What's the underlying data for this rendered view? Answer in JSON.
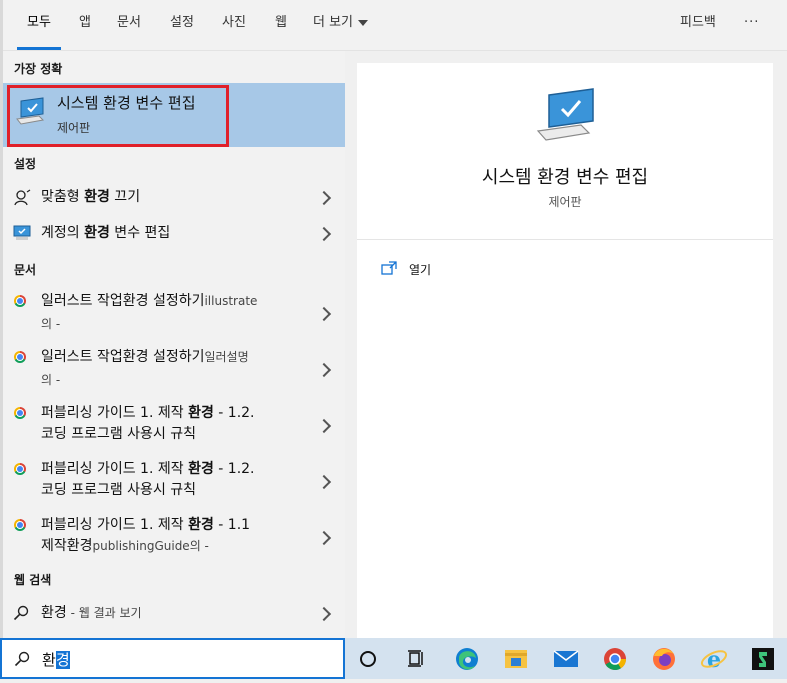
{
  "tabs": [
    {
      "label": "모두"
    },
    {
      "label": "앱"
    },
    {
      "label": "문서"
    },
    {
      "label": "설정"
    },
    {
      "label": "사진"
    },
    {
      "label": "웹"
    },
    {
      "label": "더 보기"
    }
  ],
  "feedback_label": "피드백",
  "more_options_label": "···",
  "best_match": {
    "header": "가장 정확",
    "title": "시스템 환경 변수 편집",
    "subtitle": "제어판"
  },
  "settings": {
    "header": "설정",
    "items": [
      {
        "pre": "맞춤형 ",
        "bold": "환경",
        "post": " 끄기",
        "icon": "narrator-person-icon"
      },
      {
        "pre": "계정의 ",
        "bold": "환경",
        "post": " 변수 편집",
        "icon": "monitor-icon"
      }
    ]
  },
  "documents": {
    "header": "문서",
    "items": [
      {
        "line1": "일러스트 작업환경 설정하기",
        "line1_small": "illustrate",
        "line2": "의 -"
      },
      {
        "line1": "일러스트 작업환경 설정하기",
        "line1_small": "일러설명",
        "line2": "의 -"
      },
      {
        "line1_pre": "퍼블리싱 가이드 1. 제작 ",
        "line1_bold": "환경",
        "line1_post": " - 1.2.",
        "line2": "코딩 프로그램 사용시 규칙"
      },
      {
        "line1_pre": "퍼블리싱 가이드 1. 제작 ",
        "line1_bold": "환경",
        "line1_post": " - 1.2.",
        "line2": "코딩 프로그램 사용시 규칙"
      },
      {
        "line1_pre": "퍼블리싱 가이드 1. 제작 ",
        "line1_bold": "환경",
        "line1_post": " - 1.1",
        "line2": "제작환경",
        "line2_small": "publishingGuide의 -"
      }
    ]
  },
  "web": {
    "header": "웹 검색",
    "item": {
      "query": "환경",
      "suffix": " - 웹 결과 보기"
    }
  },
  "preview": {
    "title": "시스템 환경 변수 편집",
    "subtitle": "제어판",
    "action_label": "열기"
  },
  "search": {
    "text_unselected": "환",
    "text_selected": "경"
  },
  "taskbar_icons": [
    "cortana-icon",
    "task-view-icon",
    "edge-icon",
    "file-explorer-icon",
    "mail-icon",
    "chrome-icon",
    "firefox-icon",
    "ie-icon",
    "app-icon"
  ],
  "colors": {
    "accent": "#1474d4",
    "highlight": "#a7c8e7",
    "outline": "#e0202a"
  }
}
